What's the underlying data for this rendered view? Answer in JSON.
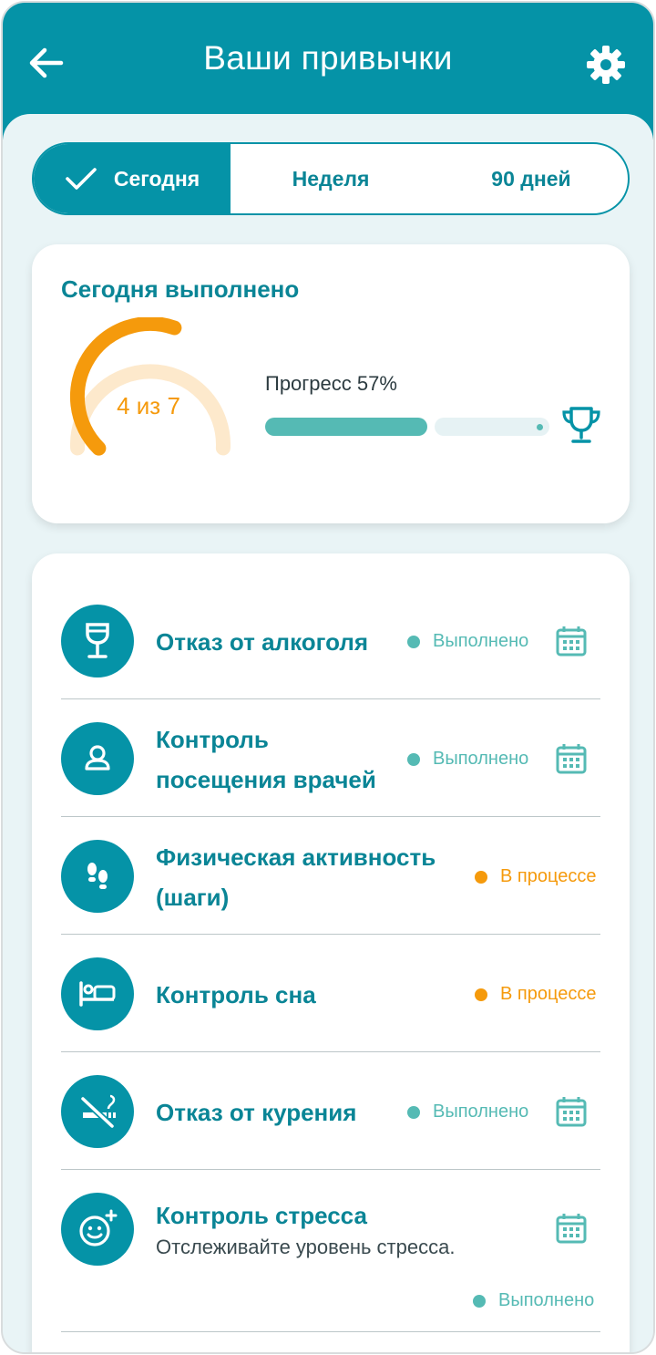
{
  "header": {
    "title": "Ваши привычки",
    "back_icon": "arrow-left-icon",
    "settings_icon": "gear-icon"
  },
  "tabs": [
    {
      "label": "Сегодня",
      "selected": true,
      "icon": "check-icon"
    },
    {
      "label": "Неделя",
      "selected": false
    },
    {
      "label": "90 дней",
      "selected": false
    }
  ],
  "summary": {
    "title": "Сегодня выполнено",
    "completed": 4,
    "total": 7,
    "gauge_label": "4 из 7",
    "progress_label": "Прогресс 57%",
    "progress_fraction": 0.57,
    "trophy_icon": "trophy-icon"
  },
  "habits": [
    {
      "name": "Отказ от алкоголя",
      "icon": "wine-glass-icon",
      "status": "Выполнено",
      "state": "done",
      "calendar": true
    },
    {
      "name_line1": "Контроль",
      "name_line2": "посещения врачей",
      "icon": "doctor-icon",
      "status": "Выполнено",
      "state": "done",
      "calendar": true
    },
    {
      "name_line1": "Физическая активность",
      "name_line2": "(шаги)",
      "icon": "footsteps-icon",
      "status": "В процессе",
      "state": "progress",
      "calendar": false
    },
    {
      "name": "Контроль сна",
      "icon": "bed-icon",
      "status": "В процессе",
      "state": "progress",
      "calendar": false
    },
    {
      "name": "Отказ от курения",
      "icon": "no-smoking-icon",
      "status": "Выполнено",
      "state": "done",
      "calendar": true
    },
    {
      "name": "Контроль стресса",
      "description": "Отслеживайте уровень стресса.",
      "icon": "smiley-plus-icon",
      "status": "Выполнено",
      "state": "done",
      "calendar": true
    }
  ],
  "colors": {
    "primary": "#0593a7",
    "text_primary": "#0a8596",
    "done": "#55bab4",
    "progress": "#f59a0c",
    "background": "#e9f4f6"
  }
}
